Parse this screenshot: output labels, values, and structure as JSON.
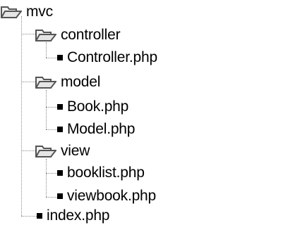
{
  "tree": {
    "root": {
      "label": "mvc",
      "icon": "open-folder-icon"
    },
    "controller": {
      "label": "controller",
      "icon": "open-folder-icon",
      "files": [
        "Controller.php"
      ]
    },
    "model": {
      "label": "model",
      "icon": "open-folder-icon",
      "files": [
        "Book.php",
        "Model.php"
      ]
    },
    "view": {
      "label": "view",
      "icon": "open-folder-icon",
      "files": [
        "booklist.php",
        "viewbook.php"
      ]
    },
    "root_files": [
      "index.php"
    ],
    "file_icon": "file-icon",
    "colors": {
      "folder_fill": "#f2f2f2",
      "folder_stroke": "#555555",
      "connector": "#8a8a8a",
      "text": "#000000"
    }
  }
}
